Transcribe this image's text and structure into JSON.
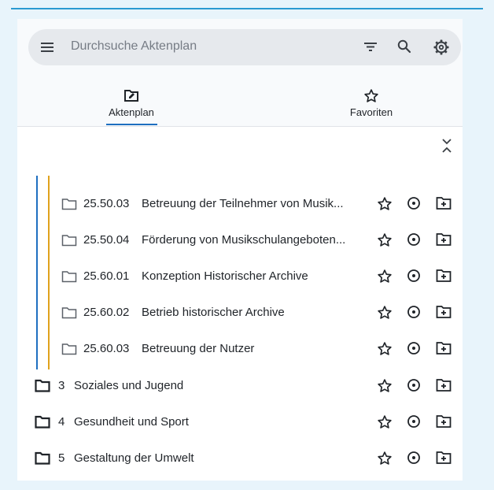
{
  "search": {
    "placeholder": "Durchsuche Aktenplan",
    "icons": [
      "menu-icon",
      "filter-icon",
      "search-icon",
      "settings-icon"
    ]
  },
  "tabs": [
    {
      "label": "Aktenplan",
      "icon": "folder-edit-icon",
      "active": true
    },
    {
      "label": "Favoriten",
      "icon": "star-icon",
      "active": false
    }
  ],
  "tree": {
    "children": [
      {
        "code": "25.50.03",
        "label": "Betreuung der Teilnehmer von Musik..."
      },
      {
        "code": "25.50.04",
        "label": "Förderung von Musikschulangeboten..."
      },
      {
        "code": "25.60.01",
        "label": "Konzeption Historischer Archive"
      },
      {
        "code": "25.60.02",
        "label": "Betrieb historischer Archive"
      },
      {
        "code": "25.60.03",
        "label": "Betreuung der Nutzer"
      }
    ],
    "top_level": [
      {
        "code": "3",
        "label": "Soziales und Jugend"
      },
      {
        "code": "4",
        "label": "Gesundheit und Sport"
      },
      {
        "code": "5",
        "label": "Gestaltung der Umwelt"
      }
    ]
  },
  "colors": {
    "accent_blue": "#1f6fc0",
    "accent_yellow": "#e0a21c",
    "top_line": "#2b9ad1",
    "background": "#e8f4fb"
  }
}
